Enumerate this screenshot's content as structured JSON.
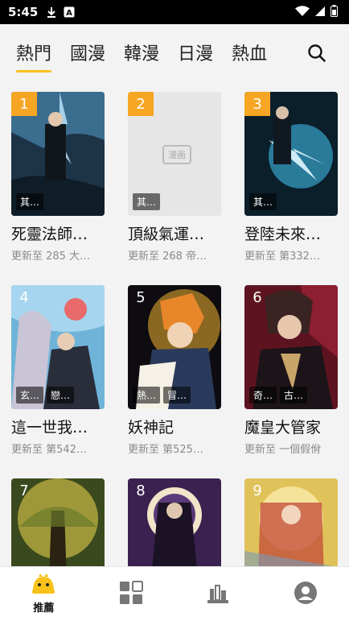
{
  "status_bar": {
    "time": "5:45",
    "icons": [
      "download-icon",
      "app-a-icon",
      "wifi-icon",
      "cellular-signal-icon",
      "battery-icon"
    ]
  },
  "tabs": [
    {
      "label": "熱門",
      "active": true
    },
    {
      "label": "國漫",
      "active": false
    },
    {
      "label": "韓漫",
      "active": false
    },
    {
      "label": "日漫",
      "active": false
    },
    {
      "label": "熱血",
      "active": false
    }
  ],
  "search": {
    "icon": "search-icon"
  },
  "comics": [
    {
      "rank": "1",
      "title": "死靈法師…",
      "update": "更新至 285 大…",
      "tags": [
        "其…"
      ],
      "placeholder": false
    },
    {
      "rank": "2",
      "title": "頂級氣運…",
      "update": "更新至 268 帝…",
      "tags": [
        "其…"
      ],
      "placeholder": true,
      "placeholder_text": "漫画"
    },
    {
      "rank": "3",
      "title": "登陸未來…",
      "update": "更新至 第332…",
      "tags": [
        "其…"
      ],
      "placeholder": false
    },
    {
      "rank": "4",
      "title": "這一世我…",
      "update": "更新至 第542…",
      "tags": [
        "玄…",
        "戀…"
      ],
      "placeholder": false
    },
    {
      "rank": "5",
      "title": "妖神記",
      "update": "更新至 第525…",
      "tags": [
        "熱…",
        "冒…"
      ],
      "placeholder": false
    },
    {
      "rank": "6",
      "title": "魔皇大管家",
      "update": "更新至 一個假佾",
      "tags": [
        "奇…",
        "古…"
      ],
      "placeholder": false
    },
    {
      "rank": "7",
      "title": "",
      "update": "",
      "tags": [],
      "placeholder": false
    },
    {
      "rank": "8",
      "title": "",
      "update": "",
      "tags": [],
      "placeholder": false
    },
    {
      "rank": "9",
      "title": "",
      "update": "",
      "tags": [],
      "placeholder": false
    }
  ],
  "bottom_nav": [
    {
      "label": "推薦",
      "icon": "recommend-mascot-icon",
      "active": true
    },
    {
      "label": "",
      "icon": "category-grid-icon",
      "active": false
    },
    {
      "label": "",
      "icon": "bookshelf-icon",
      "active": false
    },
    {
      "label": "",
      "icon": "user-profile-icon",
      "active": false
    }
  ],
  "colors": {
    "accent": "#f8c21a",
    "rank_badge": "#f6a623",
    "background": "#f3f3f3"
  }
}
